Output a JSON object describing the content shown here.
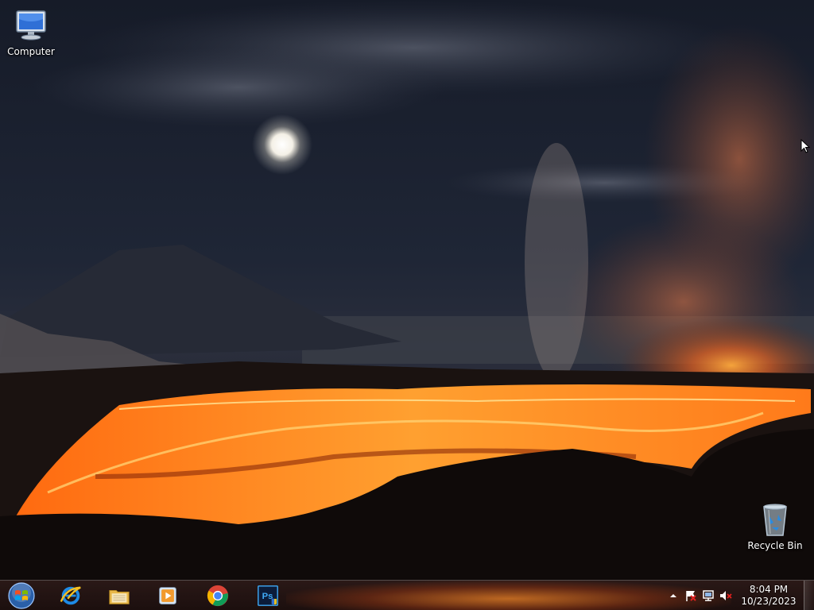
{
  "desktop_icons": {
    "computer": {
      "label": "Computer",
      "icon": "computer-icon"
    },
    "recycle_bin": {
      "label": "Recycle Bin",
      "icon": "recycle-bin-icon"
    }
  },
  "taskbar": {
    "start": {
      "icon": "windows-start-orb-icon"
    },
    "pinned": [
      {
        "name": "Internet Explorer",
        "icon": "internet-explorer-icon"
      },
      {
        "name": "Windows Explorer",
        "icon": "file-explorer-icon"
      },
      {
        "name": "Windows Media Player",
        "icon": "media-player-icon"
      },
      {
        "name": "Google Chrome",
        "icon": "chrome-icon"
      },
      {
        "name": "Adobe Photoshop",
        "icon": "photoshop-icon"
      }
    ],
    "photoshop_badge": "Ps"
  },
  "tray": {
    "icons": [
      "show-hidden-icons-arrow",
      "action-center-flag-icon",
      "network-icon",
      "volume-muted-icon"
    ],
    "time": "8:04 PM",
    "date": "10/23/2023"
  },
  "colors": {
    "lava": "#ff7a1a",
    "sky": "#1a2233",
    "taskbar_tint": "#3a1a0c"
  }
}
